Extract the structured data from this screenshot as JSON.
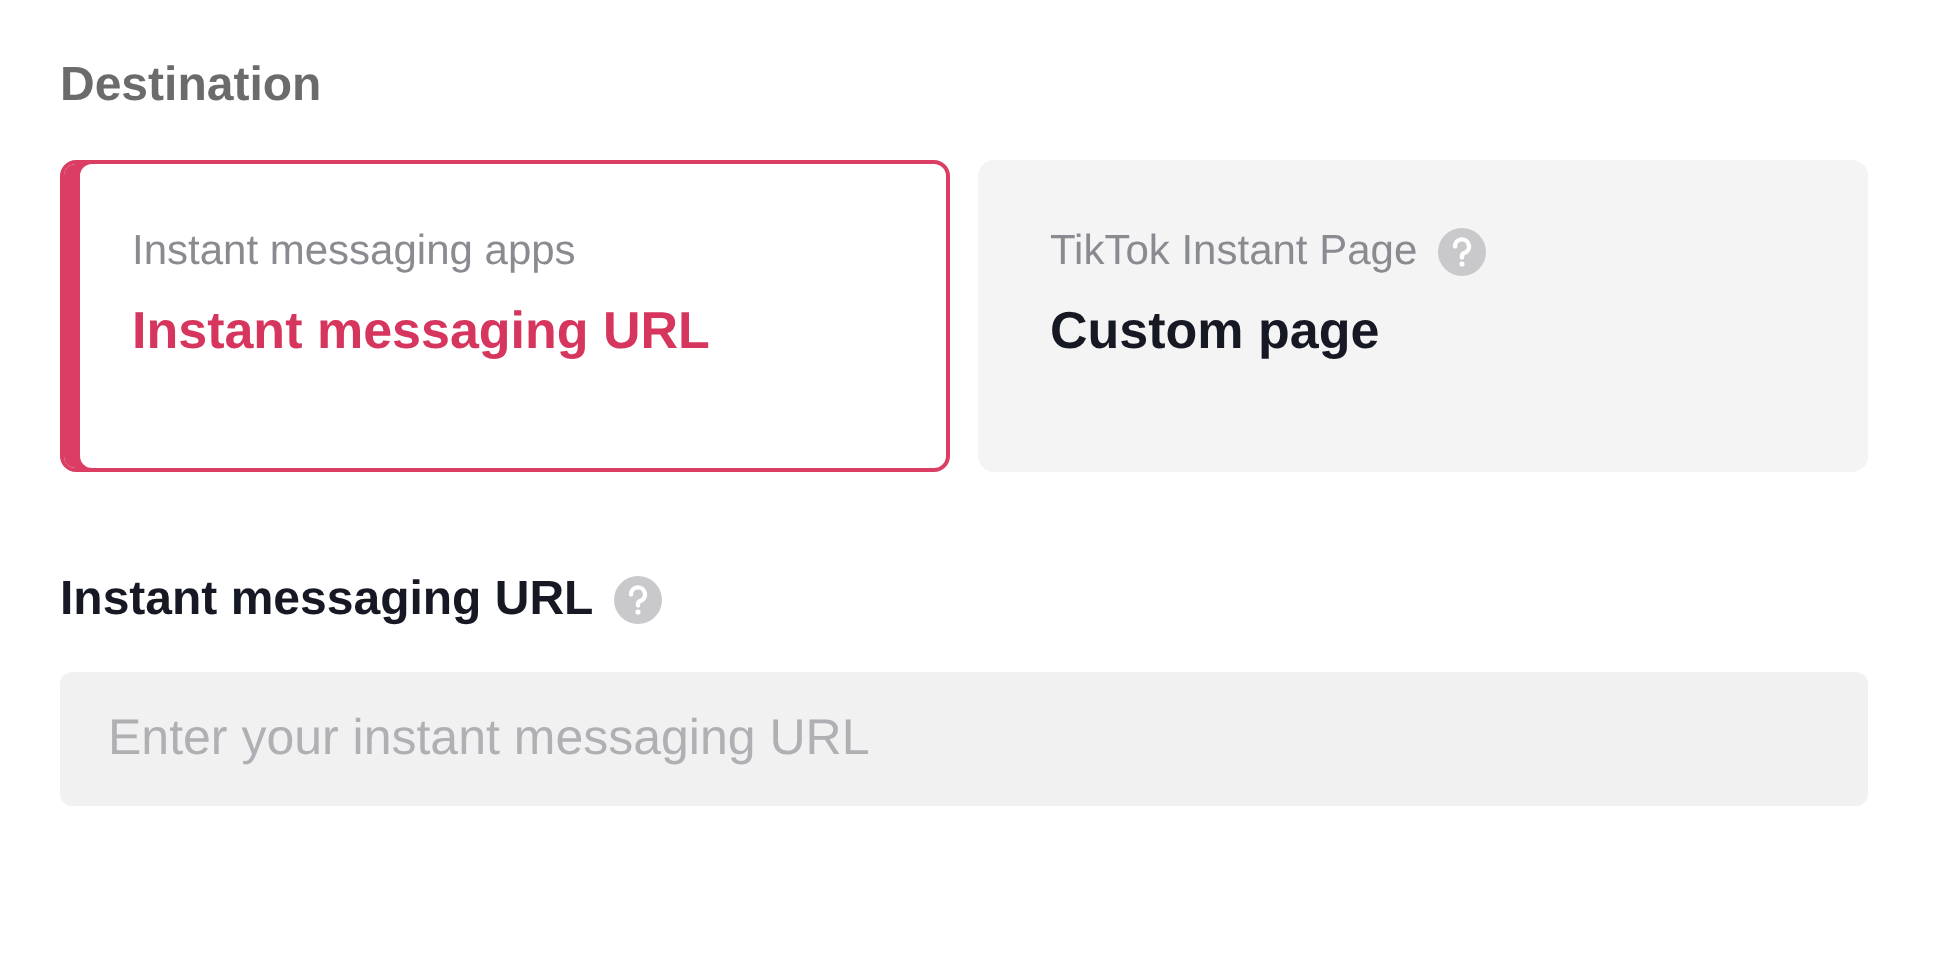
{
  "section_title": "Destination",
  "options": [
    {
      "subtitle": "Instant messaging apps",
      "title": "Instant messaging URL",
      "selected": true,
      "help": false
    },
    {
      "subtitle": "TikTok Instant Page",
      "title": "Custom page",
      "selected": false,
      "help": true
    }
  ],
  "field": {
    "label": "Instant messaging URL",
    "help": true,
    "placeholder": "Enter your instant messaging URL"
  }
}
